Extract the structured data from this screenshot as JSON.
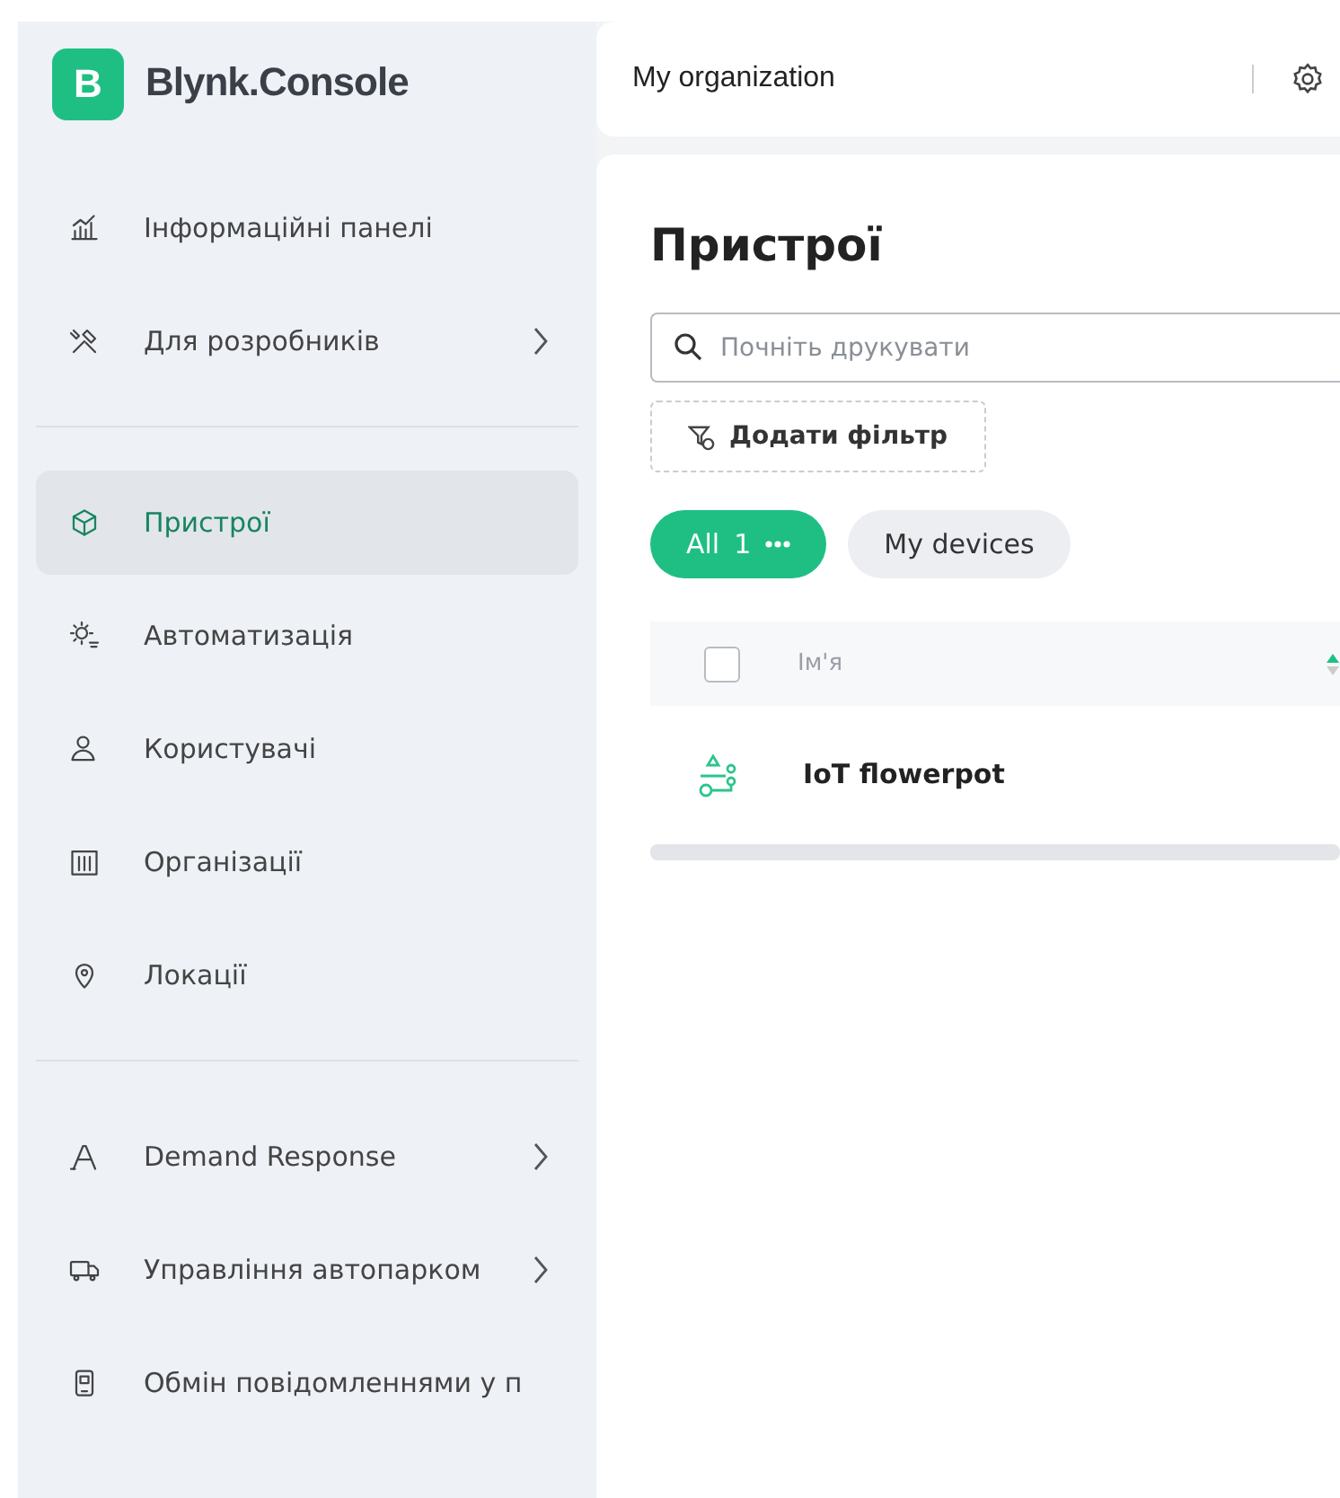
{
  "brand": {
    "logo_letter": "B",
    "name": "Blynk.Console"
  },
  "topbar": {
    "organization": "My organization"
  },
  "sidebar": {
    "groups": [
      {
        "items": [
          {
            "label": "Інформаційні панелі",
            "selected": false,
            "has_submenu": false
          },
          {
            "label": "Для розробників",
            "selected": false,
            "has_submenu": true
          }
        ]
      },
      {
        "items": [
          {
            "label": "Пристрої",
            "selected": true,
            "has_submenu": false
          },
          {
            "label": "Автоматизація",
            "selected": false,
            "has_submenu": false
          },
          {
            "label": "Користувачі",
            "selected": false,
            "has_submenu": false
          },
          {
            "label": "Організації",
            "selected": false,
            "has_submenu": false
          },
          {
            "label": "Локації",
            "selected": false,
            "has_submenu": false
          }
        ]
      },
      {
        "items": [
          {
            "label": "Demand Response",
            "selected": false,
            "has_submenu": true
          },
          {
            "label": "Управління автопарком",
            "selected": false,
            "has_submenu": true
          },
          {
            "label": "Обмін повідомленнями у п",
            "selected": false,
            "has_submenu": false
          }
        ]
      }
    ]
  },
  "page": {
    "title": "Пристрої",
    "search": {
      "placeholder": "Почніть друкувати"
    },
    "filter_button": "Додати фільтр",
    "chips": [
      {
        "label": "All",
        "count": "1",
        "selected": true
      },
      {
        "label": "My devices",
        "selected": false
      }
    ],
    "table": {
      "select_all": {
        "checked": false
      },
      "columns": [
        "Ім'я"
      ],
      "rows": [
        {
          "name": "IoT flowerpot"
        }
      ]
    }
  }
}
